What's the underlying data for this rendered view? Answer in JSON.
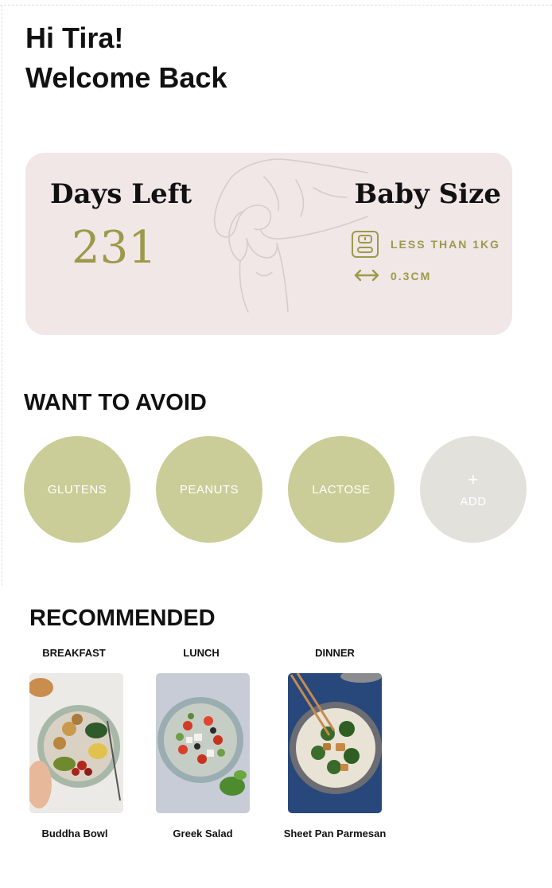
{
  "greeting": {
    "line1": "Hi Tira!",
    "line2": "Welcome Back"
  },
  "pregnancy_card": {
    "days_left_label": "Days Left",
    "days_left_value": "231",
    "baby_size_label": "Baby Size",
    "weight_text": "LESS THAN 1KG",
    "length_text": "0.3CM",
    "icons": [
      "hands-illustration",
      "scale-icon",
      "horizontal-arrow-icon"
    ]
  },
  "avoid": {
    "title": "WANT TO AVOID",
    "items": [
      "GLUTENS",
      "PEANUTS",
      "LACTOSE"
    ],
    "add_symbol": "+",
    "add_label": "ADD"
  },
  "recommended": {
    "title": "RECOMMENDED",
    "meals": [
      {
        "category": "BREAKFAST",
        "name": "Buddha Bowl"
      },
      {
        "category": "LUNCH",
        "name": "Greek Salad"
      },
      {
        "category": "DINNER",
        "name": "Sheet Pan Parmesan"
      }
    ]
  },
  "colors": {
    "card_bg": "#f1e7e7",
    "accent_olive": "#9c9a4a",
    "avoid_circle": "#cbcd98",
    "add_circle": "#e3e1dc"
  }
}
